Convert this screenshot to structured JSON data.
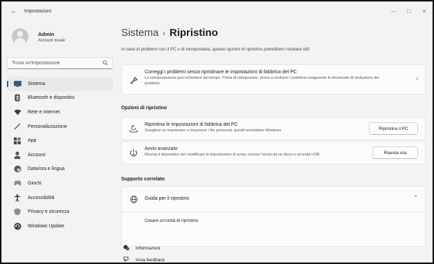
{
  "window": {
    "title": "Impostazioni",
    "controls": {
      "minimize": "—",
      "maximize": "☐",
      "close": "✕"
    }
  },
  "profile": {
    "name": "Admin",
    "subtitle": "Account locale"
  },
  "search": {
    "placeholder": "Trova un'impostazione"
  },
  "sidebar": {
    "items": [
      {
        "label": "Sistema",
        "icon": "system-icon",
        "selected": true
      },
      {
        "label": "Bluetooth e dispositivi",
        "icon": "bluetooth-icon"
      },
      {
        "label": "Rete e Internet",
        "icon": "wifi-icon"
      },
      {
        "label": "Personalizzazione",
        "icon": "brush-icon"
      },
      {
        "label": "App",
        "icon": "apps-icon"
      },
      {
        "label": "Account",
        "icon": "account-icon"
      },
      {
        "label": "Data/ora e lingua",
        "icon": "globe-clock-icon"
      },
      {
        "label": "Giochi",
        "icon": "gamepad-icon"
      },
      {
        "label": "Accessibilità",
        "icon": "accessibility-icon"
      },
      {
        "label": "Privacy e sicurezza",
        "icon": "shield-icon"
      },
      {
        "label": "Windows Update",
        "icon": "update-icon"
      }
    ]
  },
  "main": {
    "breadcrumb": {
      "parent": "Sistema",
      "separator": "›",
      "current": "Ripristino"
    },
    "intro": "In caso di problemi con il PC o di reimpostarla, queste opzioni di ripristino potrebbero risultare utili",
    "fix_card": {
      "title": "Correggi i problemi senza ripristinare le impostazioni di fabbrica del PC",
      "desc_line1": "La reimpostazione può richiedere del tempo. Prima di reimpostare, prova a risolvere i problemi eseguendo lo strumento di risoluzione dei",
      "desc_line2": "problemi",
      "chevron": "›"
    },
    "options_title": "Opzioni di ripristino",
    "reset_card": {
      "title": "Ripristina le impostazioni di fabbrica del PC",
      "desc": "Scegliere se mantenere o rimuovere i file personali, quindi reinstallare Windows",
      "button": "Ripristina il PC"
    },
    "advanced_card": {
      "title": "Avvio avanzato",
      "desc": "Riavvia il dispositivo per modificare le impostazioni di avvio, incluso l'avvio da un disco o un'unità USB",
      "button": "Riavvia ora"
    },
    "support_title": "Supporto correlato",
    "help_card": {
      "title": "Guida per il ripristino",
      "chevron": "⌃"
    },
    "help_link": "Creare un'unità di ripristino",
    "footer": {
      "info": "Informazioni",
      "feedback": "Invia feedback"
    }
  },
  "colors": {
    "accent": "#0067c0",
    "window_bg": "#f3f3f3",
    "card_bg": "#fbfbfb"
  }
}
